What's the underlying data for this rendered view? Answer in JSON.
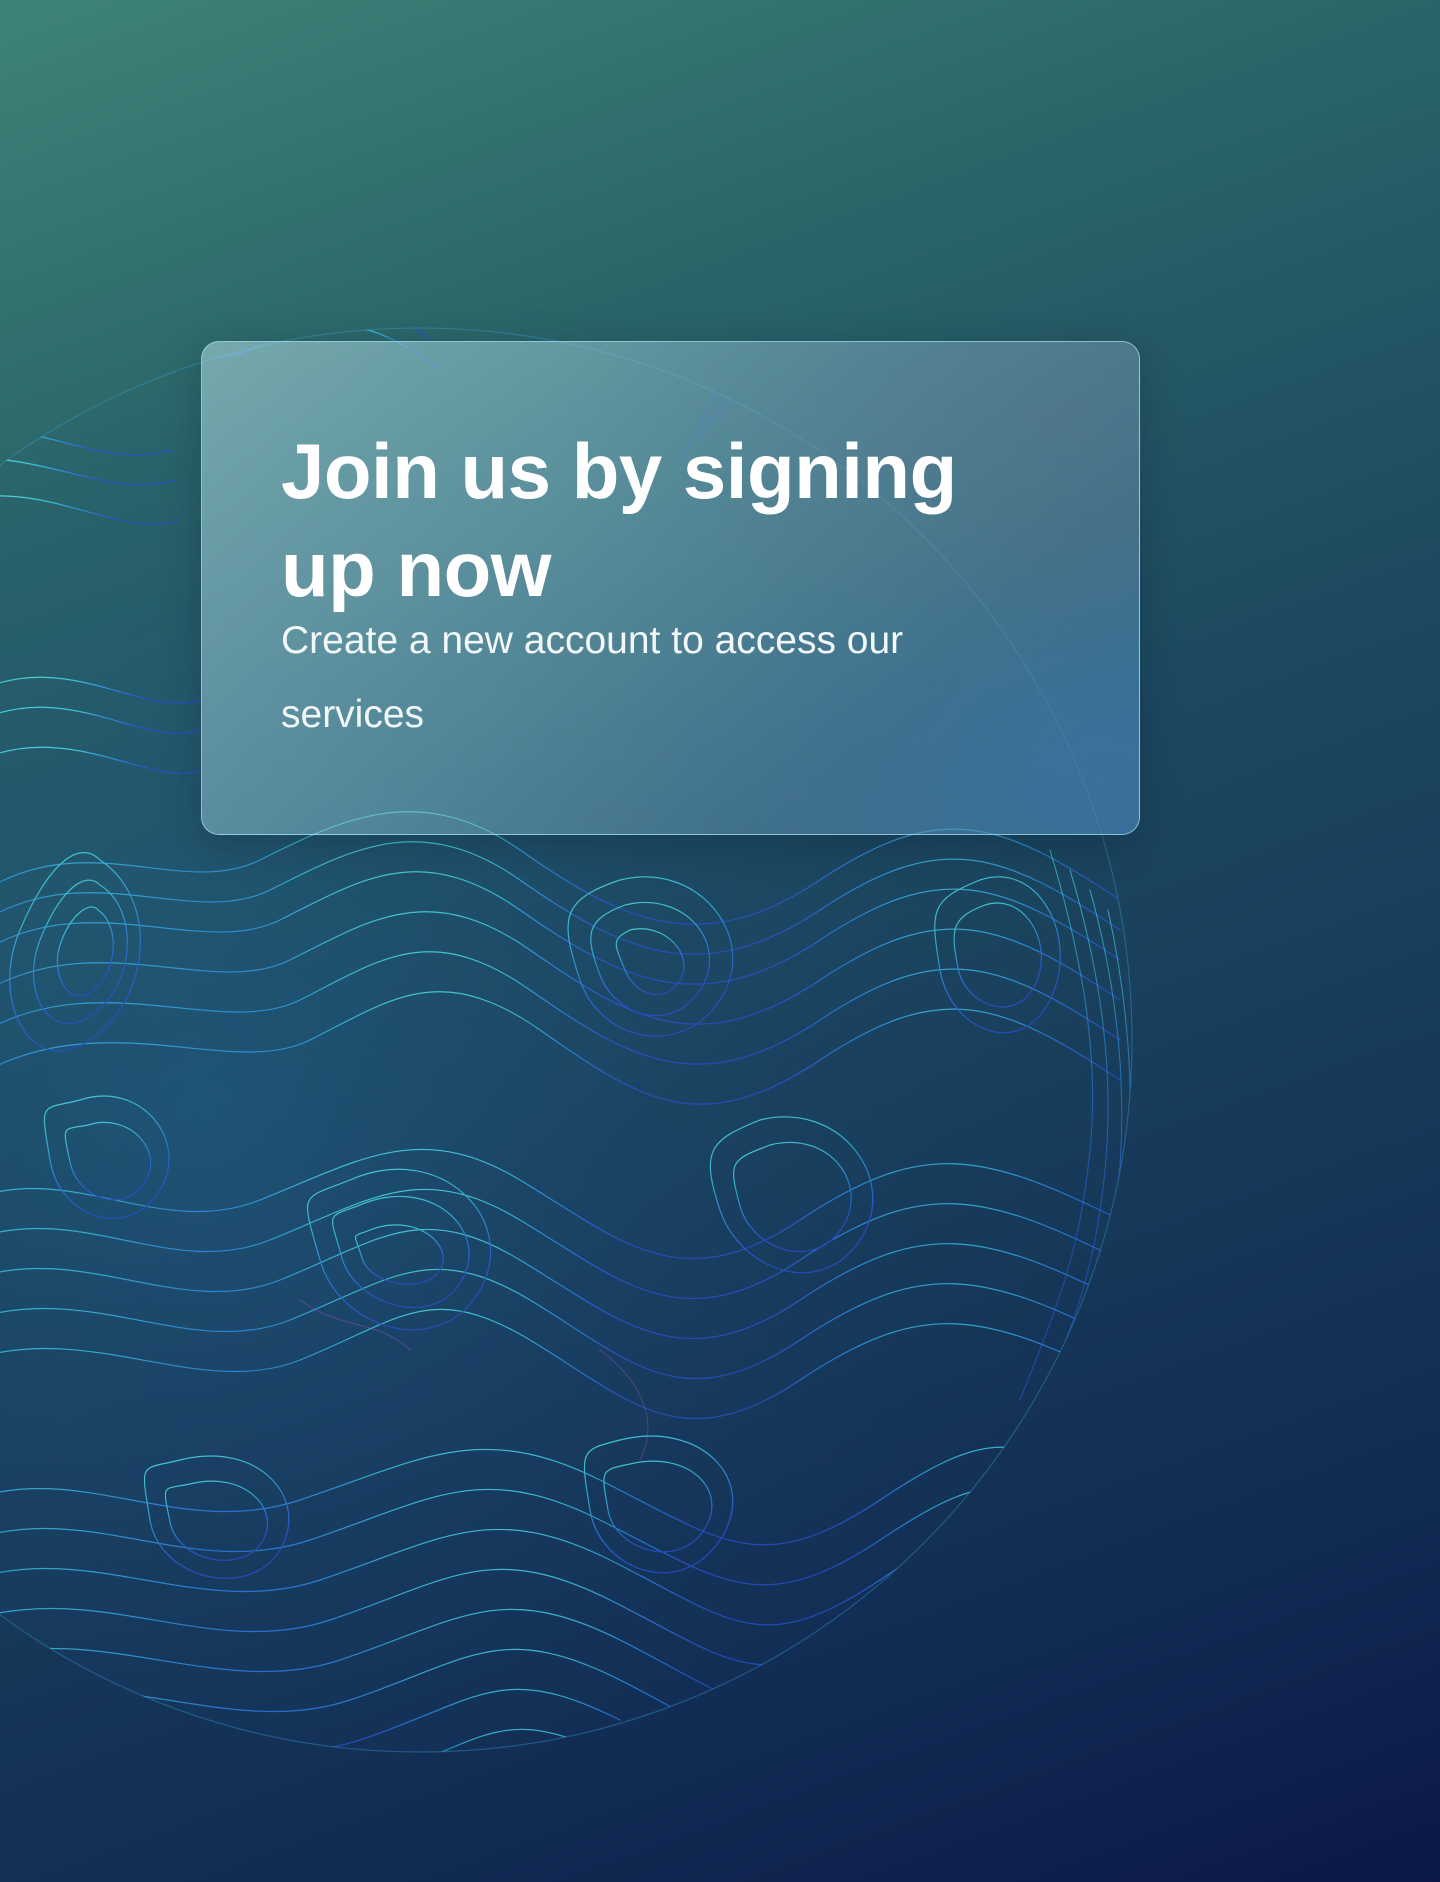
{
  "page": {
    "background": {
      "gradient_colors": [
        "#3f8378",
        "#2a6468",
        "#1d4a60",
        "#173a5a",
        "#112a52",
        "#0c1746"
      ],
      "decoration": "topographic-contour-sphere",
      "line_colors": [
        "#4fe3e6",
        "#3ab0e8",
        "#2f6fe0",
        "#c05ad0"
      ]
    }
  },
  "hero_card": {
    "headline": "Join us by signing up now",
    "subtitle": "Create a new account to access our services"
  }
}
